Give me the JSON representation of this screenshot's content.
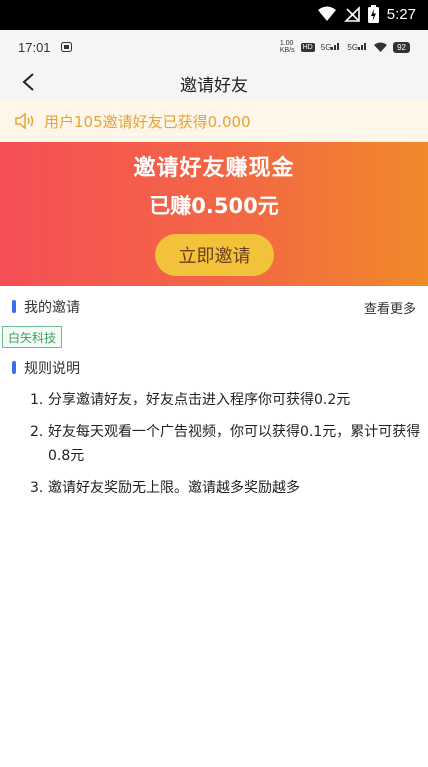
{
  "system": {
    "time": "5:27"
  },
  "status": {
    "time": "17:01",
    "net_speed_top": "1.00",
    "net_speed_bottom": "KB/s",
    "hd": "HD",
    "sig1": "5G",
    "sig2": "5G",
    "battery": "92"
  },
  "nav": {
    "title": "邀请好友"
  },
  "notice": {
    "text": "用户105邀请好友已获得0.000"
  },
  "banner": {
    "title": "邀请好友赚现金",
    "earned": "已赚0.500元",
    "invite_button": "立即邀请"
  },
  "my_invites": {
    "label": "我的邀请",
    "more": "查看更多",
    "items": [
      "白矢科技"
    ]
  },
  "rules": {
    "label": "规则说明",
    "items": [
      {
        "num": "1.",
        "text": "分享邀请好友，好友点击进入程序你可获得0.2元"
      },
      {
        "num": "2.",
        "text": "好友每天观看一个广告视频，你可以获得0.1元，累计可获得0.8元"
      },
      {
        "num": "3.",
        "text": "邀请好友奖励无上限。邀请越多奖励越多"
      }
    ]
  },
  "colors": {
    "accent_blue": "#3d6cf0",
    "banner_start": "#f44e56",
    "banner_end": "#f08a2a",
    "button_gold": "#f2c23b",
    "notice_text": "#e8a336"
  }
}
